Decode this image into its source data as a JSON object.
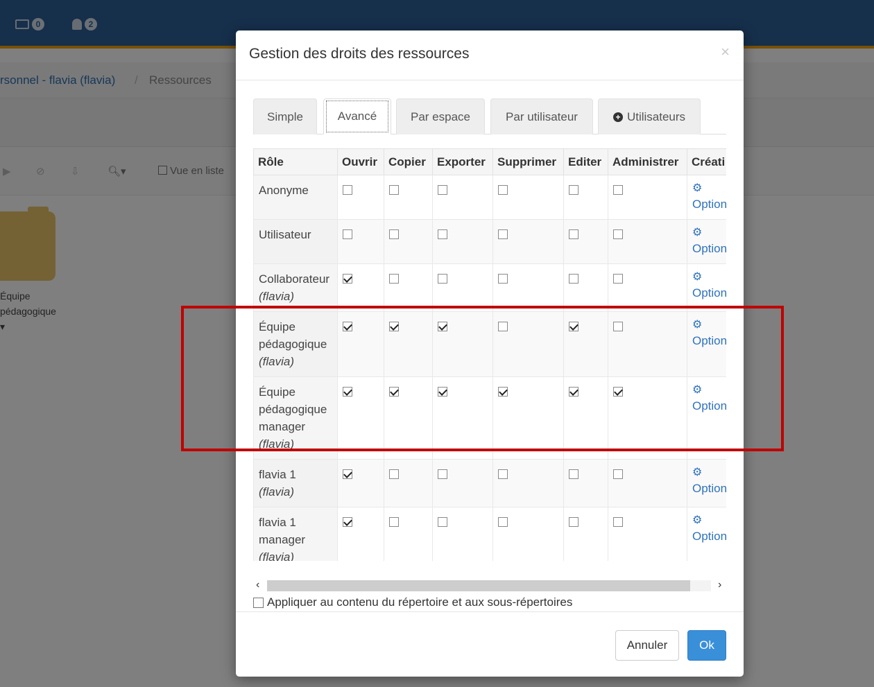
{
  "topbar": {
    "mail_badge": "0",
    "bell_badge": "2"
  },
  "breadcrumb": {
    "item1": "rsonnel - flavia (flavia)",
    "separator": "/",
    "item2": "Ressources"
  },
  "toolbar": {
    "list_view_label": "Vue en liste"
  },
  "folder": {
    "label": "Équipe pédagogique ▾"
  },
  "modal": {
    "title": "Gestion des droits des ressources",
    "close": "×",
    "tabs": [
      {
        "label": "Simple"
      },
      {
        "label": "Avancé"
      },
      {
        "label": "Par espace"
      },
      {
        "label": "Par utilisateur"
      },
      {
        "label": "Utilisateurs",
        "icon": "plus-circle-icon"
      }
    ],
    "table": {
      "headers": [
        "Rôle",
        "Ouvrir",
        "Copier",
        "Exporter",
        "Supprimer",
        "Editer",
        "Administrer",
        "Créati"
      ],
      "option_label": "Option",
      "rows": [
        {
          "role": "Anonyme",
          "sub": "",
          "checks": [
            false,
            false,
            false,
            false,
            false,
            false
          ]
        },
        {
          "role": "Utilisateur",
          "sub": "",
          "checks": [
            false,
            false,
            false,
            false,
            false,
            false
          ]
        },
        {
          "role": "Collaborateur",
          "sub": "(flavia)",
          "checks": [
            true,
            false,
            false,
            false,
            false,
            false
          ]
        },
        {
          "role": "Équipe pédagogique",
          "sub": "(flavia)",
          "checks": [
            true,
            true,
            true,
            false,
            true,
            false
          ]
        },
        {
          "role": "Équipe pédagogique manager",
          "sub": "(flavia)",
          "checks": [
            true,
            true,
            true,
            true,
            true,
            true
          ]
        },
        {
          "role": "flavia 1",
          "sub": "(flavia)",
          "checks": [
            true,
            false,
            false,
            false,
            false,
            false
          ]
        },
        {
          "role": "flavia 1 manager",
          "sub": "(flavia)",
          "checks": [
            true,
            false,
            false,
            false,
            false,
            false
          ]
        }
      ]
    },
    "scroll": {
      "left": "‹",
      "right": "›"
    },
    "apply_label": "Appliquer au contenu du répertoire et aux sous-répertoires",
    "cancel_label": "Annuler",
    "ok_label": "Ok"
  },
  "colors": {
    "topbar": "#2c5f96",
    "topbar_accent": "#f0a30a",
    "link": "#2f72bd",
    "primary_button": "#3a8fd9",
    "highlight": "#c00000"
  }
}
